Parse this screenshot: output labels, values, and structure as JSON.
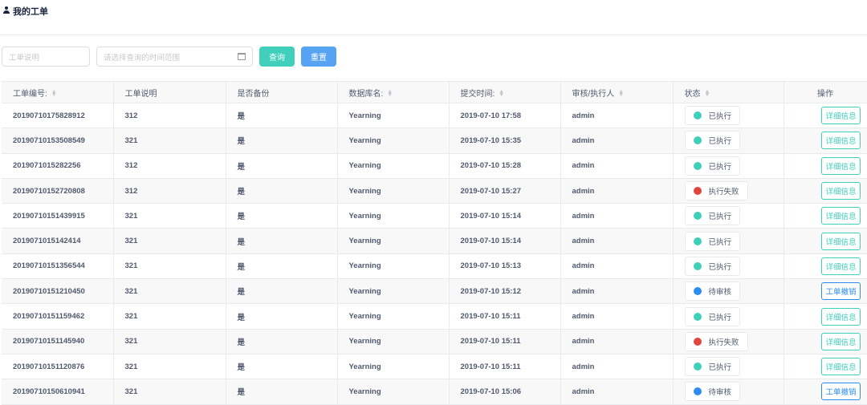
{
  "page": {
    "title": "我的工单",
    "icon": "user-icon"
  },
  "filters": {
    "desc_placeholder": "工单说明",
    "date_placeholder": "请选择查询的时间范围",
    "query_label": "查询",
    "reset_label": "重置"
  },
  "colors": {
    "executed": "#3fcfbb",
    "failed": "#e0463f",
    "pending": "#2d8cf0",
    "query": "#3fcfbb",
    "reset": "#57a3f3"
  },
  "table": {
    "headers": [
      "工单编号:",
      "工单说明",
      "是否备份",
      "数据库名:",
      "提交时间:",
      "审核/执行人",
      "状态",
      "操作"
    ],
    "rows": [
      {
        "id": "20190710175828912",
        "desc": "312",
        "backup": "是",
        "db": "Yearning",
        "time": "2019-07-10 17:58",
        "user": "admin",
        "status": "已执行",
        "state": "executed",
        "action": "详细信息"
      },
      {
        "id": "20190710153508549",
        "desc": "321",
        "backup": "是",
        "db": "Yearning",
        "time": "2019-07-10 15:35",
        "user": "admin",
        "status": "已执行",
        "state": "executed",
        "action": "详细信息"
      },
      {
        "id": "2019071015282256",
        "desc": "312",
        "backup": "是",
        "db": "Yearning",
        "time": "2019-07-10 15:28",
        "user": "admin",
        "status": "已执行",
        "state": "executed",
        "action": "详细信息"
      },
      {
        "id": "20190710152720808",
        "desc": "312",
        "backup": "是",
        "db": "Yearning",
        "time": "2019-07-10 15:27",
        "user": "admin",
        "status": "执行失败",
        "state": "failed",
        "action": "详细信息"
      },
      {
        "id": "20190710151439915",
        "desc": "321",
        "backup": "是",
        "db": "Yearning",
        "time": "2019-07-10 15:14",
        "user": "admin",
        "status": "已执行",
        "state": "executed",
        "action": "详细信息"
      },
      {
        "id": "2019071015142414",
        "desc": "321",
        "backup": "是",
        "db": "Yearning",
        "time": "2019-07-10 15:14",
        "user": "admin",
        "status": "已执行",
        "state": "executed",
        "action": "详细信息"
      },
      {
        "id": "20190710151356544",
        "desc": "321",
        "backup": "是",
        "db": "Yearning",
        "time": "2019-07-10 15:13",
        "user": "admin",
        "status": "已执行",
        "state": "executed",
        "action": "详细信息"
      },
      {
        "id": "20190710151210450",
        "desc": "321",
        "backup": "是",
        "db": "Yearning",
        "time": "2019-07-10 15:12",
        "user": "admin",
        "status": "待审核",
        "state": "pending",
        "action": "工单撤销"
      },
      {
        "id": "20190710151159462",
        "desc": "321",
        "backup": "是",
        "db": "Yearning",
        "time": "2019-07-10 15:11",
        "user": "admin",
        "status": "已执行",
        "state": "executed",
        "action": "详细信息"
      },
      {
        "id": "20190710151145940",
        "desc": "321",
        "backup": "是",
        "db": "Yearning",
        "time": "2019-07-10 15:11",
        "user": "admin",
        "status": "执行失败",
        "state": "failed",
        "action": "详细信息"
      },
      {
        "id": "20190710151120876",
        "desc": "321",
        "backup": "是",
        "db": "Yearning",
        "time": "2019-07-10 15:11",
        "user": "admin",
        "status": "已执行",
        "state": "executed",
        "action": "详细信息"
      },
      {
        "id": "20190710150610941",
        "desc": "321",
        "backup": "是",
        "db": "Yearning",
        "time": "2019-07-10 15:06",
        "user": "admin",
        "status": "待审核",
        "state": "pending",
        "action": "工单撤销"
      }
    ]
  }
}
